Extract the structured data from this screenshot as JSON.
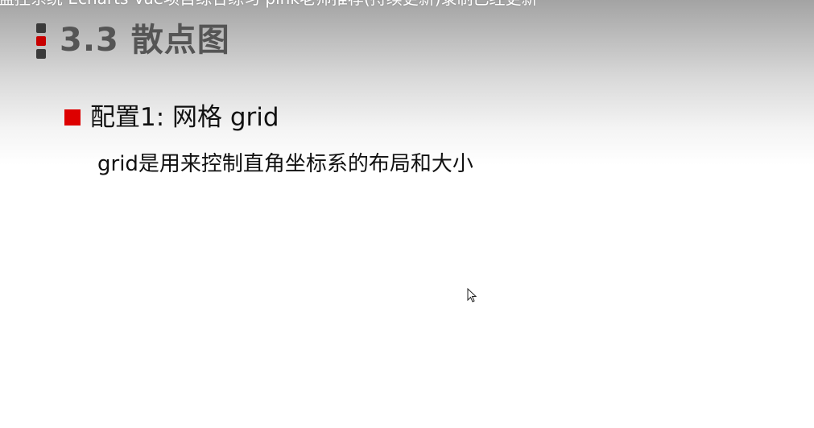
{
  "video": {
    "title": "监控系统 Echarts Vue项目综合练习 pink老师推荐(持续更新)录制已经更新"
  },
  "slide": {
    "heading": "3.3 散点图",
    "bullet": "配置1: 网格 grid",
    "description": "grid是用来控制直角坐标系的布局和大小"
  },
  "colors": {
    "accent": "#dd0000",
    "heading_text": "#555555",
    "marker_dark": "#3a3a3a"
  },
  "icons": {
    "cursor": "arrow-cursor-icon"
  }
}
